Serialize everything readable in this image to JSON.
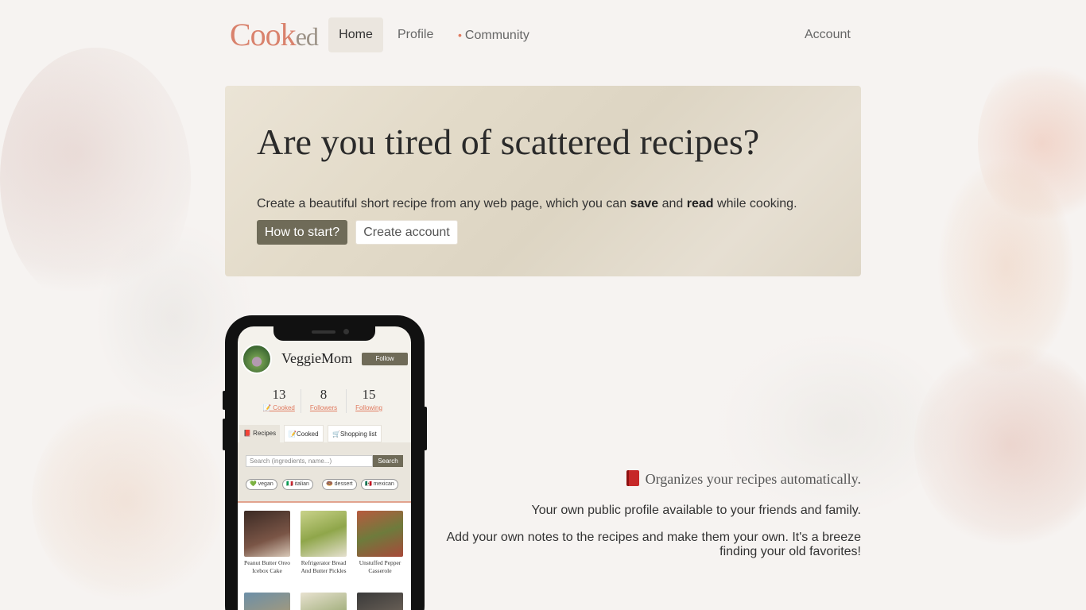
{
  "nav": {
    "logo": {
      "main": "Cook",
      "suffix": "ed"
    },
    "home": "Home",
    "profile": "Profile",
    "community_dot": "•",
    "community": "Community",
    "account": "Account"
  },
  "hero": {
    "title": "Are you tired of scattered recipes?",
    "subtitle_before": "Create a beautiful short recipe from any web page, which you can ",
    "subtitle_save": "save",
    "subtitle_and": " and ",
    "subtitle_read": "read",
    "subtitle_after": " while cooking.",
    "btn_start": "How to start?",
    "btn_create": "Create account"
  },
  "phone": {
    "username": "VeggieMom",
    "follow": "Follow",
    "stats": [
      {
        "num": "13",
        "label": "📝 Cooked"
      },
      {
        "num": "8",
        "label": "Followers"
      },
      {
        "num": "15",
        "label": "Following"
      }
    ],
    "tabs": [
      "📕 Recipes",
      "📝Cooked",
      "🛒Shopping list"
    ],
    "search_placeholder": "Search (ingredients, name...)",
    "search_btn": "Search",
    "tags": [
      "💚 vegan",
      "🇮🇹 italian",
      "🍩 dessert",
      "🇲🇽 mexican"
    ],
    "recipes": [
      {
        "name": "Peanut Butter Oreo Icebox Cake",
        "color": "#5a3e33"
      },
      {
        "name": "Refrigerator Bread And Butter Pickles",
        "color": "#8fa64a"
      },
      {
        "name": "Unstuffed Pepper Casserole",
        "color": "#a8493a"
      }
    ]
  },
  "features": {
    "title": "Organizes your recipes automatically.",
    "p1": "Your own public profile available to your friends and family.",
    "p2": "Add your own notes to the recipes and make them your own. It's a breeze finding your old favorites!"
  }
}
